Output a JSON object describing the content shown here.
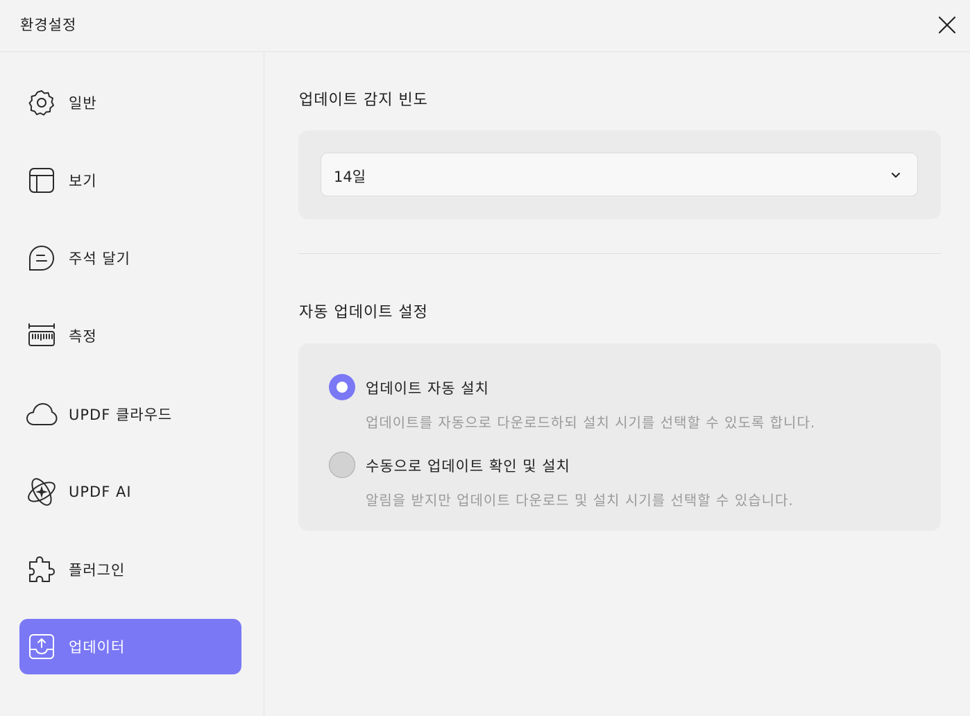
{
  "window": {
    "title": "환경설정"
  },
  "sidebar": {
    "items": [
      {
        "label": "일반",
        "icon": "gear-icon"
      },
      {
        "label": "보기",
        "icon": "layout-icon"
      },
      {
        "label": "주석 달기",
        "icon": "comment-icon"
      },
      {
        "label": "측정",
        "icon": "ruler-icon"
      },
      {
        "label": "UPDF 클라우드",
        "icon": "cloud-icon"
      },
      {
        "label": "UPDF AI",
        "icon": "ai-icon"
      },
      {
        "label": "플러그인",
        "icon": "puzzle-icon"
      },
      {
        "label": "업데이터",
        "icon": "upload-tray-icon",
        "active": true
      }
    ]
  },
  "main": {
    "frequency": {
      "title": "업데이트 감지 빈도",
      "selected": "14일"
    },
    "auto_update": {
      "title": "자동 업데이트 설정",
      "options": [
        {
          "title": "업데이트 자동 설치",
          "description": "업데이트를 자동으로 다운로드하되 설치 시기를 선택할 수 있도록 합니다.",
          "selected": true
        },
        {
          "title": "수동으로 업데이트 확인 및 설치",
          "description": "알림을 받지만 업데이트 다운로드 및 설치 시기를 선택할 수 있습니다.",
          "selected": false
        }
      ]
    }
  },
  "colors": {
    "accent": "#7a78f5",
    "background": "#f3f3f3",
    "card": "#ebebeb",
    "muted_text": "#9a9a9a"
  }
}
